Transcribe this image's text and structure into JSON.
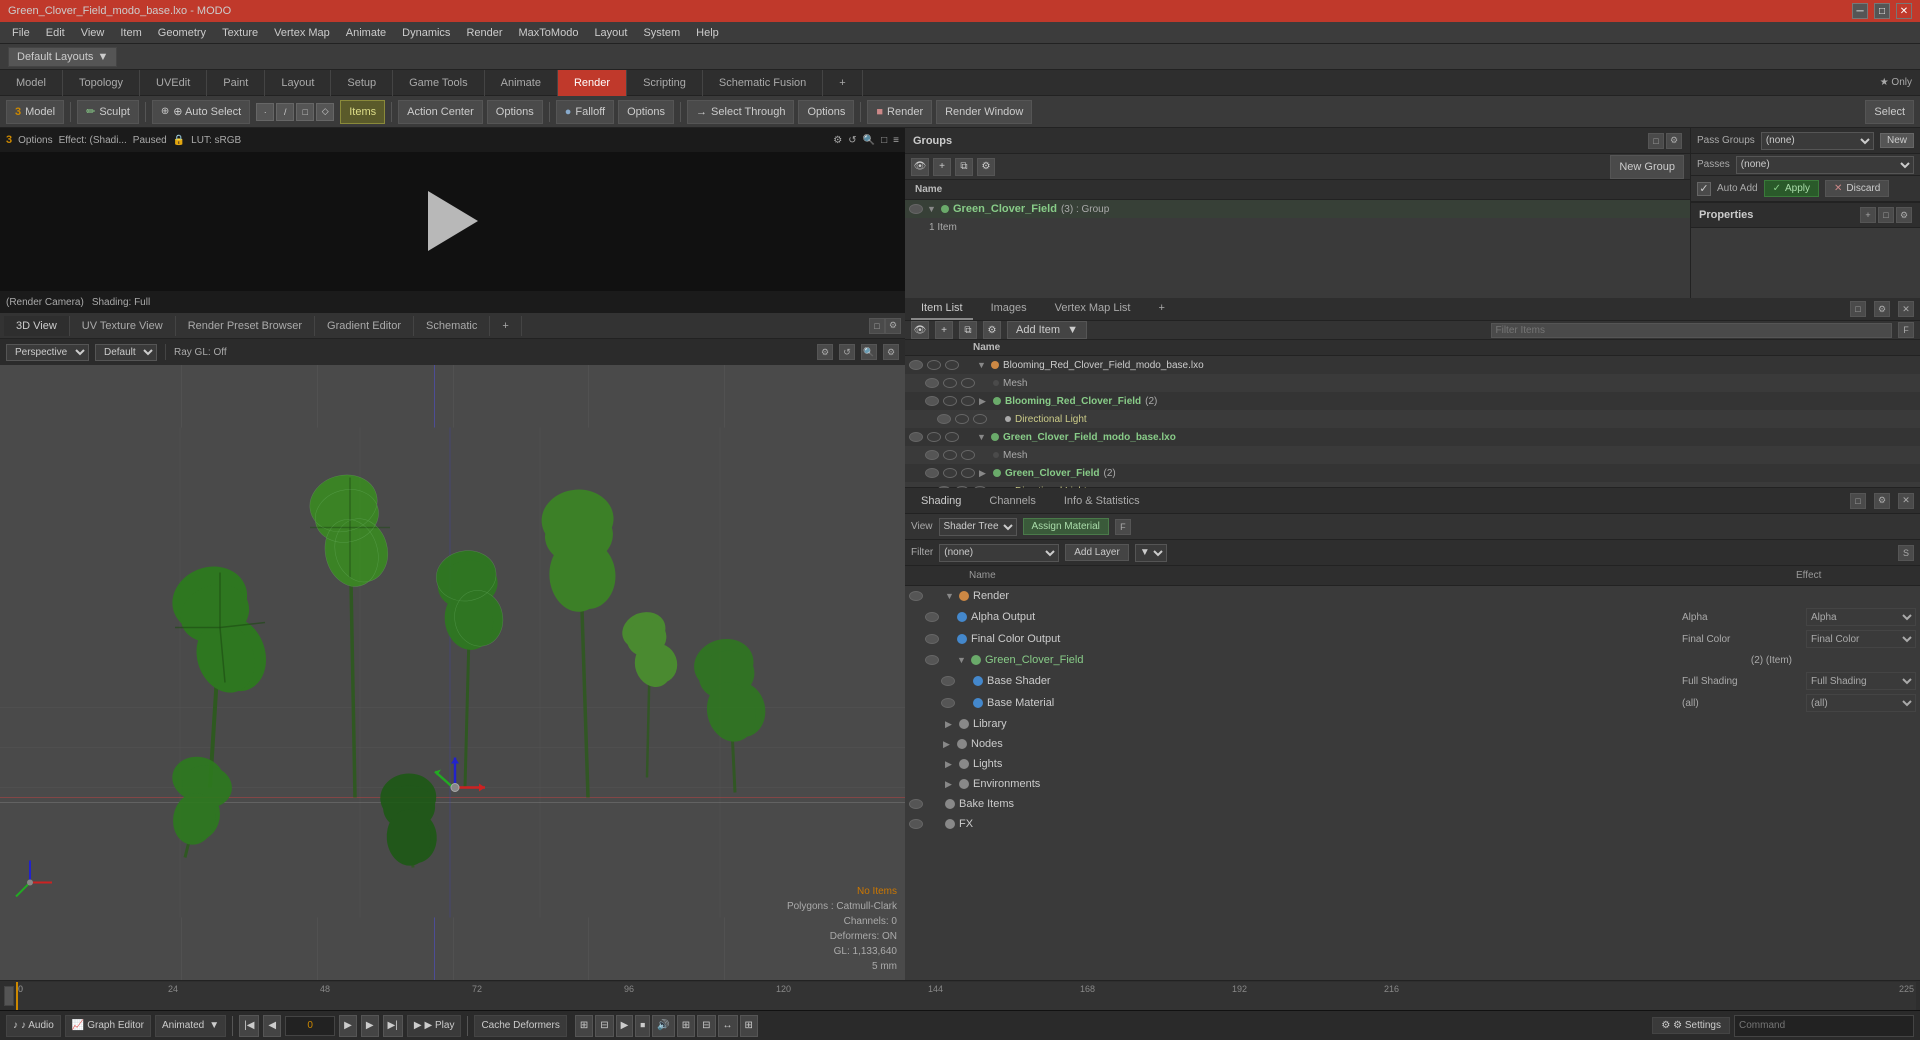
{
  "app": {
    "title": "Green_Clover_Field_modo_base.lxo - MODO",
    "layout": "Default Layouts"
  },
  "titlebar": {
    "title": "Green_Clover_Field_modo_base.lxo - MODO",
    "minimize": "─",
    "maximize": "□",
    "close": "✕"
  },
  "menubar": {
    "items": [
      "File",
      "Edit",
      "View",
      "Item",
      "Geometry",
      "Texture",
      "Vertex Map",
      "Animate",
      "Dynamics",
      "Render",
      "MaxToModo",
      "Layout",
      "System",
      "Help"
    ]
  },
  "toolbar1": {
    "layout_label": "Default Layouts",
    "layout_arrow": "▼"
  },
  "toolbar2": {
    "tabs": [
      "Model",
      "Topology",
      "UVEdit",
      "Paint",
      "Layout",
      "Setup",
      "Game Tools",
      "Animate",
      "Render",
      "Scripting",
      "Schematic Fusion"
    ],
    "active": "Render",
    "plus": "+"
  },
  "toolbar3": {
    "model_label": "3 Model",
    "sculpt_label": "✏ Sculpt",
    "autoselect_label": "⊕ Auto Select",
    "items_label": "Items",
    "action_center_label": "Action Center",
    "options1_label": "Options",
    "falloff_label": "● Falloff",
    "options2_label": "Options",
    "select_through_label": "→ Select Through",
    "options3_label": "Options",
    "render_label": "■ Render",
    "render_window_label": "Render Window",
    "select_label": "Select"
  },
  "render_panel": {
    "options_label": "3 Options",
    "effect_label": "Effect: (Shadi...",
    "paused_label": "Paused",
    "lut_label": "LUT: sRGB",
    "camera_label": "(Render Camera)",
    "shading_label": "Shading: Full"
  },
  "viewport_tabs": {
    "tabs": [
      "3D View",
      "UV Texture View",
      "Render Preset Browser",
      "Gradient Editor",
      "Schematic"
    ],
    "active": "3D View",
    "plus": "+"
  },
  "view3d": {
    "perspective_label": "Perspective",
    "default_label": "Default",
    "ray_gl_label": "Ray GL: Off",
    "no_items": "No Items",
    "stats": {
      "polygons": "Polygons : Catmull-Clark",
      "channels": "Channels: 0",
      "deformers": "Deformers: ON",
      "gl": "GL: 1,133,640",
      "scale": "5 mm"
    }
  },
  "groups_panel": {
    "title": "Groups",
    "new_group_label": "New Group",
    "col_name": "Name",
    "group_item": {
      "name": "Green_Clover_Field",
      "tag": "(3) : Group",
      "sub": "1 Item"
    }
  },
  "properties_panel": {
    "pass_groups_label": "Pass Groups",
    "passes_label": "Passes",
    "none_option": "(none)",
    "new_btn": "New",
    "auto_add_label": "Auto Add",
    "apply_label": "Apply",
    "discard_label": "Discard",
    "properties_label": "Properties",
    "plus": "+"
  },
  "item_list": {
    "tabs": [
      "Item List",
      "Images",
      "Vertex Map List"
    ],
    "active": "Item List",
    "plus": "+",
    "add_item_btn": "Add Item",
    "filter_placeholder": "Filter Items",
    "col_name": "Name",
    "f_btn": "F",
    "items": [
      {
        "id": 1,
        "indent": 0,
        "expanded": true,
        "name": "Blooming_Red_Clover_Field_modo_base.lxo",
        "type": "scene"
      },
      {
        "id": 2,
        "indent": 1,
        "expanded": false,
        "name": "Mesh",
        "type": "mesh"
      },
      {
        "id": 3,
        "indent": 1,
        "expanded": true,
        "name": "Blooming_Red_Clover_Field",
        "tag": "(2)",
        "type": "group"
      },
      {
        "id": 4,
        "indent": 2,
        "expanded": false,
        "name": "Directional Light",
        "type": "light"
      },
      {
        "id": 5,
        "indent": 0,
        "expanded": true,
        "name": "Green_Clover_Field_modo_base.lxo",
        "type": "scene"
      },
      {
        "id": 6,
        "indent": 1,
        "expanded": false,
        "name": "Mesh",
        "type": "mesh"
      },
      {
        "id": 7,
        "indent": 1,
        "expanded": true,
        "name": "Green_Clover_Field",
        "tag": "(2)",
        "type": "group"
      },
      {
        "id": 8,
        "indent": 2,
        "expanded": false,
        "name": "Directional Light",
        "type": "light"
      }
    ]
  },
  "shader_panel": {
    "tabs": [
      "Shading",
      "Channels",
      "Info & Statistics"
    ],
    "active": "Shading",
    "view_label": "View",
    "shader_tree_label": "Shader Tree",
    "assign_material_label": "Assign Material",
    "f_btn": "F",
    "filter_label": "Filter",
    "none_option": "(none)",
    "add_layer_label": "Add Layer",
    "s_btn": "S",
    "col_name": "Name",
    "col_effect": "Effect",
    "items": [
      {
        "id": 1,
        "indent": 0,
        "expanded": true,
        "name": "Render",
        "effect": "",
        "dot_color": "orange"
      },
      {
        "id": 2,
        "indent": 1,
        "name": "Alpha Output",
        "effect": "Alpha",
        "dot_color": "blue"
      },
      {
        "id": 3,
        "indent": 1,
        "name": "Final Color Output",
        "effect": "Final Color",
        "dot_color": "blue"
      },
      {
        "id": 4,
        "indent": 1,
        "expanded": true,
        "name": "Green_Clover_Field",
        "tag": "(2) (Item)",
        "effect": "",
        "dot_color": "green"
      },
      {
        "id": 5,
        "indent": 2,
        "name": "Base Shader",
        "effect": "Full Shading",
        "dot_color": "blue"
      },
      {
        "id": 6,
        "indent": 2,
        "name": "Base Material",
        "effect": "(all)",
        "dot_color": "blue"
      },
      {
        "id": 7,
        "indent": 0,
        "expanded": true,
        "name": "Library",
        "effect": "",
        "dot_color": "gray"
      },
      {
        "id": 8,
        "indent": 1,
        "expanded": false,
        "name": "Nodes",
        "effect": "",
        "dot_color": "gray"
      },
      {
        "id": 9,
        "indent": 0,
        "expanded": false,
        "name": "Lights",
        "effect": "",
        "dot_color": "gray"
      },
      {
        "id": 10,
        "indent": 0,
        "expanded": false,
        "name": "Environments",
        "effect": "",
        "dot_color": "gray"
      },
      {
        "id": 11,
        "indent": 0,
        "name": "Bake Items",
        "effect": "",
        "dot_color": "gray"
      },
      {
        "id": 12,
        "indent": 0,
        "name": "FX",
        "effect": "",
        "dot_color": "gray"
      }
    ]
  },
  "timeline": {
    "markers": [
      "0",
      "24",
      "48",
      "72",
      "96",
      "120",
      "144",
      "168",
      "192",
      "216"
    ],
    "current_frame": "0",
    "end_frame": "225",
    "indicator_pos": "0"
  },
  "bottombar": {
    "audio_label": "♪ Audio",
    "graph_editor_label": "Graph Editor",
    "animated_label": "Animated",
    "play_label": "▶ Play",
    "cache_label": "Cache Deformers",
    "settings_label": "⚙ Settings"
  }
}
